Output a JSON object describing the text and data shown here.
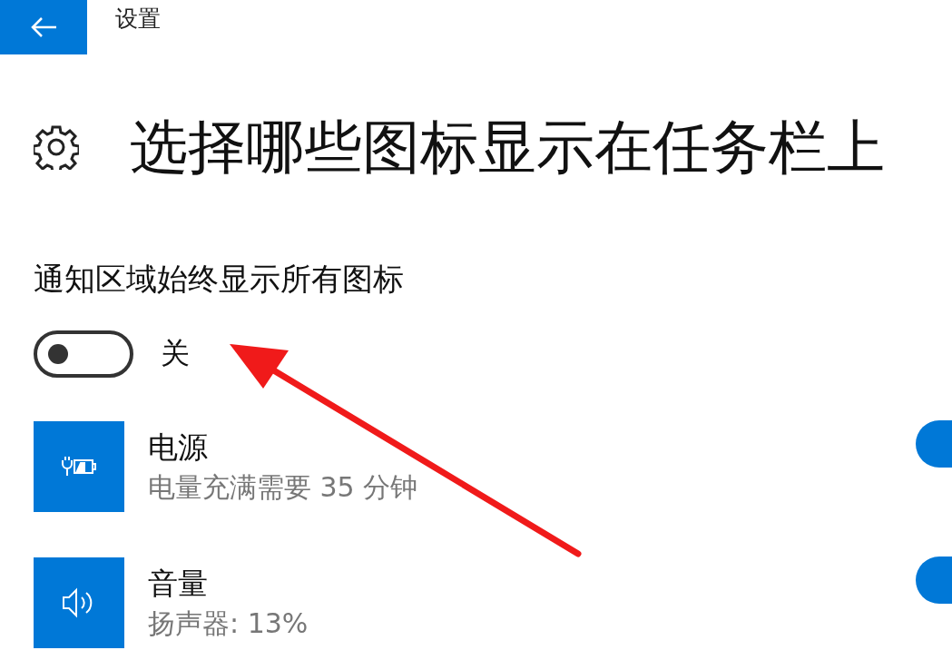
{
  "window": {
    "title": "设置"
  },
  "heading": "选择哪些图标显示在任务栏上",
  "always_show": {
    "label": "通知区域始终显示所有图标",
    "on": false,
    "state_text": "关"
  },
  "items": [
    {
      "kind": "power",
      "title": "电源",
      "subtitle": "电量充满需要 35 分钟",
      "on": true
    },
    {
      "kind": "volume",
      "title": "音量",
      "subtitle": "扬声器: 13%",
      "on": true
    }
  ]
}
